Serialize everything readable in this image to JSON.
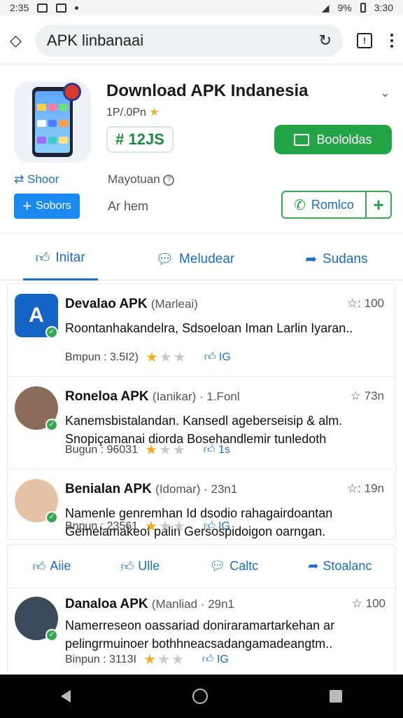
{
  "status": {
    "time_left": "2:35",
    "battery": "9%",
    "time_right": "3:30"
  },
  "browser": {
    "url": "APK linbanaai",
    "tabs": "!"
  },
  "app": {
    "title": "Download APK Indanesia",
    "subtitle": "1P/.0Pn",
    "version": "# 12JS",
    "download_label": "Boololdas",
    "share_label": "Shoor",
    "mayotuan": "Mayotuan",
    "sobors_label": "Sobors",
    "ar_hem": "Ar hem",
    "romlco_label": "Romlco"
  },
  "tabs": [
    {
      "label": "Initar",
      "active": true
    },
    {
      "label": "Meludear",
      "active": false
    },
    {
      "label": "Sudans",
      "active": false
    }
  ],
  "reviews_top": [
    {
      "name": "Devalao APK",
      "meta": "(Marleai)",
      "rating_label": "☆: 100",
      "text": "Roontanhakandelra, Sdsoeloan Iman Larlin Iyaran..",
      "foot": "Bmpun : 3.5I2)",
      "likes": "IG",
      "avatar": "apk-logo"
    },
    {
      "name": "Roneloa APK",
      "meta": "(Ianikar) · 1.Fonl",
      "rating_label": "☆ 73n",
      "text": "Kanemsbistalandan. Kansedl ageberseisip & alm. Snopiçamanai diorda Bosehandlemir tunledoth",
      "foot": "Bugun : 96031",
      "likes": "1s",
      "avatar": "man"
    },
    {
      "name": "Benialan APK",
      "meta": "(Idomar) · 23n1",
      "rating_label": "☆: 19n",
      "text": "Namenle genremhan Id dsodio rahagairdoantan Gemelamakeof palin Gersospidoigon oarngan.",
      "foot": "Bnpun : 23561",
      "likes": "IG",
      "avatar": "woman"
    }
  ],
  "actions": [
    {
      "label": "Aiie",
      "icon": "thumb-icon"
    },
    {
      "label": "Ulle",
      "icon": "thumb-icon"
    },
    {
      "label": "Caltc",
      "icon": "bubble-icon"
    },
    {
      "label": "Stoalanc",
      "icon": "share-icon"
    }
  ],
  "reviews_bottom": [
    {
      "name": "Danaloa APK",
      "meta": "(Manliad · 29n1",
      "rating_label": "☆ 100",
      "text": "Namerreseon oassariad doniraramartarkehan ar pelingrmuinoer bothhneacsadangamadeangtm..",
      "foot": "Binpun : 3113I",
      "likes": "IG",
      "avatar": "man2"
    }
  ]
}
